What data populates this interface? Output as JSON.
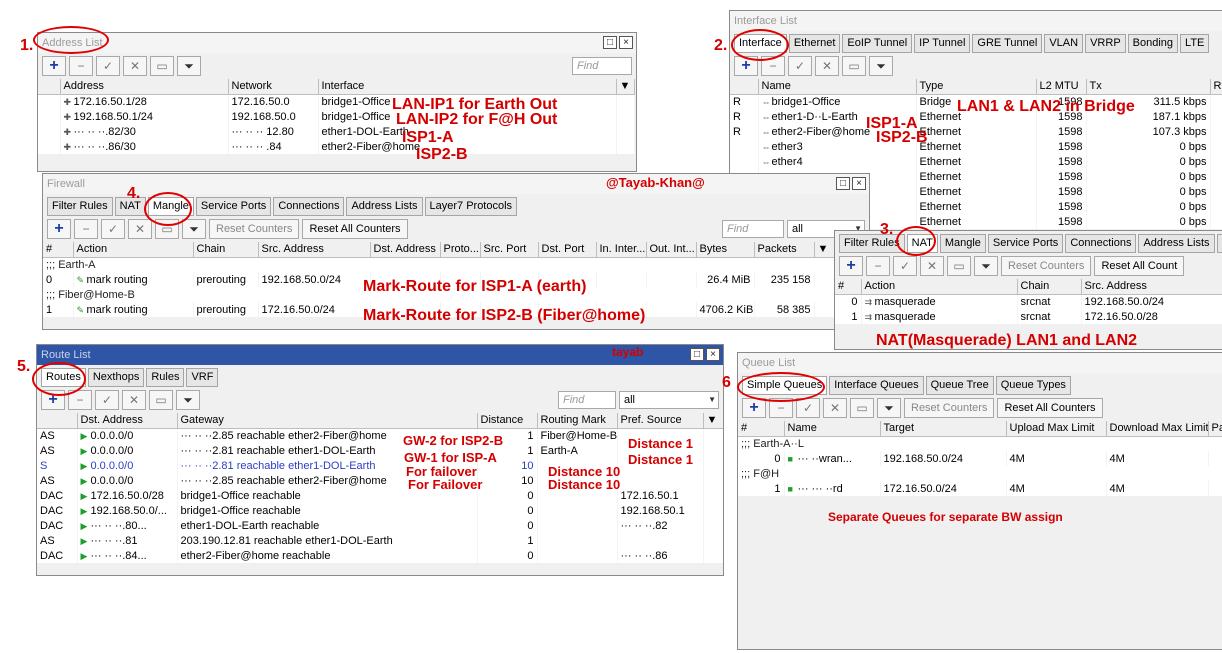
{
  "address_list": {
    "title": "Address List",
    "find_placeholder": "Find",
    "columns": [
      "Address",
      "Network",
      "Interface"
    ],
    "rows": [
      {
        "address": "172.16.50.1/28",
        "network": "172.16.50.0",
        "interface": "bridge1-Office"
      },
      {
        "address": "192.168.50.1/24",
        "network": "192.168.50.0",
        "interface": "bridge1-Office"
      },
      {
        "address": "··· ·· ··.82/30",
        "network": "··· ·· ·· 12.80",
        "interface": "ether1-DOL-Earth"
      },
      {
        "address": "··· ·· ··.86/30",
        "network": "··· ·· ·· .84",
        "interface": "ether2-Fiber@home"
      }
    ]
  },
  "interface_list": {
    "title": "Interface List",
    "tabs": [
      "Interface",
      "Ethernet",
      "EoIP Tunnel",
      "IP Tunnel",
      "GRE Tunnel",
      "VLAN",
      "VRRP",
      "Bonding",
      "LTE"
    ],
    "columns": [
      "Name",
      "Type",
      "L2 MTU",
      "Tx",
      "Rx"
    ],
    "rows": [
      {
        "flag": "R",
        "name": "bridge1-Office",
        "type": "Bridge",
        "mtu": "1598",
        "tx": "311.5 kbps"
      },
      {
        "flag": "R",
        "name": "ether1-D··L-Earth",
        "type": "Ethernet",
        "mtu": "1598",
        "tx": "187.1 kbps"
      },
      {
        "flag": "R",
        "name": "ether2-Fiber@home",
        "type": "Ethernet",
        "mtu": "1598",
        "tx": "107.3 kbps"
      },
      {
        "flag": "",
        "name": "ether3",
        "type": "Ethernet",
        "mtu": "1598",
        "tx": "0 bps"
      },
      {
        "flag": "",
        "name": "ether4",
        "type": "Ethernet",
        "mtu": "1598",
        "tx": "0 bps"
      },
      {
        "flag": "",
        "name": "",
        "type": "Ethernet",
        "mtu": "1598",
        "tx": "0 bps"
      },
      {
        "flag": "",
        "name": "",
        "type": "Ethernet",
        "mtu": "1598",
        "tx": "0 bps"
      },
      {
        "flag": "",
        "name": "",
        "type": "Ethernet",
        "mtu": "1598",
        "tx": "0 bps"
      },
      {
        "flag": "",
        "name": "",
        "type": "Ethernet",
        "mtu": "1598",
        "tx": "0 bps"
      }
    ]
  },
  "firewall": {
    "title": "Firewall",
    "tabs": [
      "Filter Rules",
      "NAT",
      "Mangle",
      "Service Ports",
      "Connections",
      "Address Lists",
      "Layer7 Protocols"
    ],
    "reset_counters": "Reset Counters",
    "reset_all_counters": "Reset All Counters",
    "find_placeholder": "Find",
    "filter_value": "all",
    "columns": [
      "#",
      "Action",
      "Chain",
      "Src. Address",
      "Dst. Address",
      "Proto...",
      "Src. Port",
      "Dst. Port",
      "In. Inter...",
      "Out. Int...",
      "Bytes",
      "Packets"
    ],
    "groups": [
      {
        "comment": ";;; Earth-A",
        "id": "0",
        "action": "mark routing",
        "chain": "prerouting",
        "src": "192.168.50.0/24",
        "bytes": "26.4 MiB",
        "packets": "235 158"
      },
      {
        "comment": ";;; Fiber@Home-B",
        "id": "1",
        "action": "mark routing",
        "chain": "prerouting",
        "src": "172.16.50.0/24",
        "bytes": "4706.2 KiB",
        "packets": "58 385"
      }
    ]
  },
  "nat_panel": {
    "tabs": [
      "Filter Rules",
      "NAT",
      "Mangle",
      "Service Ports",
      "Connections",
      "Address Lists",
      "Laye"
    ],
    "reset_counters": "Reset Counters",
    "reset_all_counters": "Reset All Count",
    "columns": [
      "#",
      "Action",
      "Chain",
      "Src. Address"
    ],
    "rows": [
      {
        "id": "0",
        "action": "masquerade",
        "chain": "srcnat",
        "src": "192.168.50.0/24"
      },
      {
        "id": "1",
        "action": "masquerade",
        "chain": "srcnat",
        "src": "172.16.50.0/28"
      }
    ]
  },
  "route_list": {
    "title": "Route List",
    "tabs": [
      "Routes",
      "Nexthops",
      "Rules",
      "VRF"
    ],
    "find_placeholder": "Find",
    "filter_value": "all",
    "columns": [
      "Dst. Address",
      "Gateway",
      "Distance",
      "Routing Mark",
      "Pref. Source"
    ],
    "rows": [
      {
        "flag": "AS",
        "dst": "0.0.0.0/0",
        "gw": "··· ·· ··2.85 reachable ether2-Fiber@home",
        "dist": "1",
        "mark": "Fiber@Home-B",
        "pref": "",
        "blue": false
      },
      {
        "flag": "AS",
        "dst": "0.0.0.0/0",
        "gw": "··· ·· ··2.81 reachable ether1-DOL-Earth",
        "dist": "1",
        "mark": "Earth-A",
        "pref": "",
        "blue": false
      },
      {
        "flag": "S",
        "dst": "0.0.0.0/0",
        "gw": "··· ·· ··2.81 reachable ether1-DOL-Earth",
        "dist": "10",
        "mark": "",
        "pref": "",
        "blue": true
      },
      {
        "flag": "AS",
        "dst": "0.0.0.0/0",
        "gw": "··· ·· ··2.85 reachable ether2-Fiber@home",
        "dist": "10",
        "mark": "",
        "pref": "",
        "blue": false
      },
      {
        "flag": "DAC",
        "dst": "172.16.50.0/28",
        "gw": "bridge1-Office reachable",
        "dist": "0",
        "mark": "",
        "pref": "172.16.50.1",
        "blue": false
      },
      {
        "flag": "DAC",
        "dst": "192.168.50.0/...",
        "gw": "bridge1-Office reachable",
        "dist": "0",
        "mark": "",
        "pref": "192.168.50.1",
        "blue": false
      },
      {
        "flag": "DAC",
        "dst": "··· ·· ··.80...",
        "gw": "ether1-DOL-Earth reachable",
        "dist": "0",
        "mark": "",
        "pref": "··· ·· ··.82",
        "blue": false
      },
      {
        "flag": "AS",
        "dst": "··· ·· ··.81",
        "gw": "203.190.12.81 reachable ether1-DOL-Earth",
        "dist": "1",
        "mark": "",
        "pref": "",
        "blue": false
      },
      {
        "flag": "DAC",
        "dst": "··· ·· ··.84...",
        "gw": "ether2-Fiber@home reachable",
        "dist": "0",
        "mark": "",
        "pref": "··· ·· ··.86",
        "blue": false
      }
    ]
  },
  "queue_list": {
    "title": "Queue List",
    "tabs": [
      "Simple Queues",
      "Interface Queues",
      "Queue Tree",
      "Queue Types"
    ],
    "reset_counters": "Reset Counters",
    "reset_all_counters": "Reset All Counters",
    "columns": [
      "#",
      "Name",
      "Target",
      "Upload Max Limit",
      "Download Max Limit",
      "Pa"
    ],
    "groups": [
      {
        "comment": ";;; Earth-A··L",
        "id": "0",
        "name": "··· ··wran...",
        "target": "192.168.50.0/24",
        "up": "4M",
        "down": "4M"
      },
      {
        "comment": ";;; F@H",
        "id": "1",
        "name": "··· ··· ··rd",
        "target": "172.16.50.0/24",
        "up": "4M",
        "down": "4M"
      }
    ]
  },
  "annotations": {
    "n1": "1.",
    "n2": "2.",
    "n3": "3.",
    "n4": "4.",
    "n5": "5.",
    "n6": "6",
    "lan_ip1": "LAN-IP1 for Earth Out",
    "lan_ip2": "LAN-IP2 for F@H Out",
    "isp1_a": "ISP1-A",
    "isp2_b": "ISP2-B",
    "lan_bridge": "LAN1 & LAN2 in Bridge",
    "isp1_a_if": "ISP1-A",
    "isp2_b_if": "ISP2-B",
    "author": "@Tayab-Khan@",
    "mark_route1": "Mark-Route for ISP1-A (earth)",
    "mark_route2": "Mark-Route for ISP2-B (Fiber@home)",
    "nat_note": "NAT(Masquerade) LAN1 and LAN2",
    "tayab": "tayab",
    "gw2": "GW-2 for ISP2-B",
    "gw1": "GW-1 for ISP-A",
    "failover1": "For failover",
    "failover2": "For Failover",
    "dist1a": "Distance 1",
    "dist1b": "Distance 1",
    "dist10a": "Distance 10",
    "dist10b": "Distance 10",
    "queues_note": "Separate Queues for separate BW assign"
  },
  "colors": {
    "annotation": "#d40000",
    "accent_blue": "#1a3fa6",
    "route_title": "#2f55a6"
  }
}
